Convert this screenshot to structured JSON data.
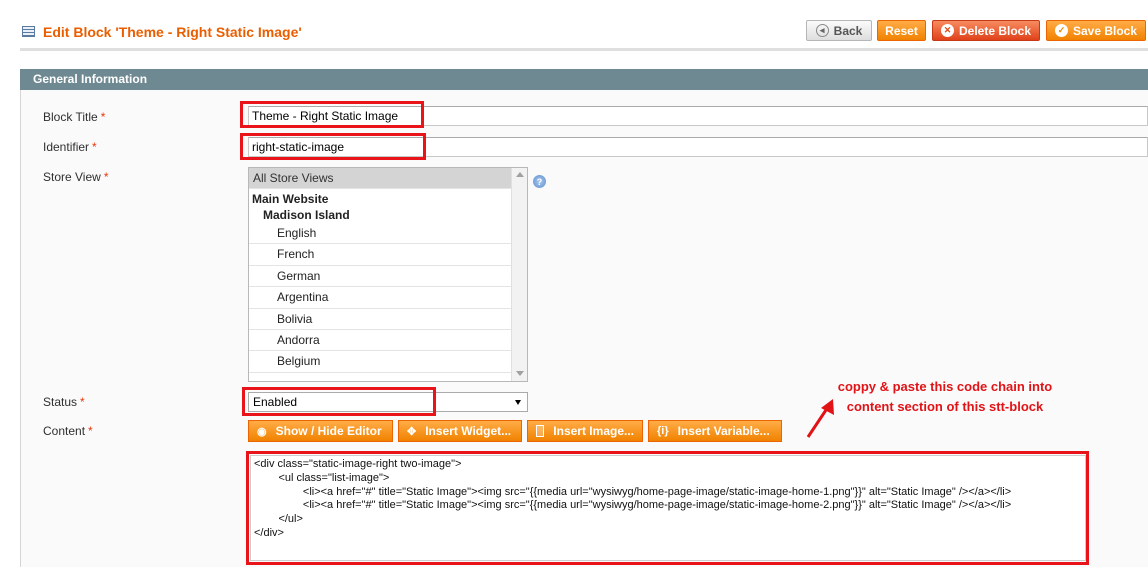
{
  "page": {
    "title": "Edit Block 'Theme - Right Static Image'"
  },
  "toolbar": {
    "back_label": "Back",
    "reset_label": "Reset",
    "delete_label": "Delete Block",
    "save_label": "Save Block"
  },
  "section": {
    "title": "General Information"
  },
  "form": {
    "block_title": {
      "label": "Block Title",
      "required": "*",
      "value": "Theme - Right Static Image"
    },
    "identifier": {
      "label": "Identifier",
      "required": "*",
      "value": "right-static-image"
    },
    "store_view": {
      "label": "Store View",
      "required": "*",
      "selected": "All Store Views",
      "group": "Main Website",
      "subgroup": "Madison Island",
      "options": [
        "English",
        "French",
        "German",
        "Argentina",
        "Bolivia",
        "Andorra",
        "Belgium"
      ]
    },
    "status": {
      "label": "Status",
      "required": "*",
      "value": "Enabled"
    },
    "content": {
      "label": "Content",
      "required": "*",
      "buttons": {
        "show_hide": "Show / Hide Editor",
        "insert_widget": "Insert Widget...",
        "insert_image": "Insert Image...",
        "insert_variable": "Insert Variable..."
      },
      "code_lines": [
        "<div class=\"static-image-right two-image\">",
        "        <ul class=\"list-image\">",
        "                <li><a href=\"#\" title=\"Static Image\"><img src=\"{{media url=\"wysiwyg/home-page-image/static-image-home-1.png\"}}\" alt=\"Static Image\" /></a></li>",
        "                <li><a href=\"#\" title=\"Static Image\"><img src=\"{{media url=\"wysiwyg/home-page-image/static-image-home-2.png\"}}\" alt=\"Static Image\" /></a></li>",
        "        </ul>",
        "</div>"
      ]
    }
  },
  "annotation": {
    "line1": "coppy & paste this code chain into",
    "line2": "content section of this stt-block"
  },
  "colors": {
    "title_orange": "#eb5e00",
    "button_orange": "#f18200",
    "section_header": "#6f8992",
    "highlight_red": "#e8141a"
  }
}
